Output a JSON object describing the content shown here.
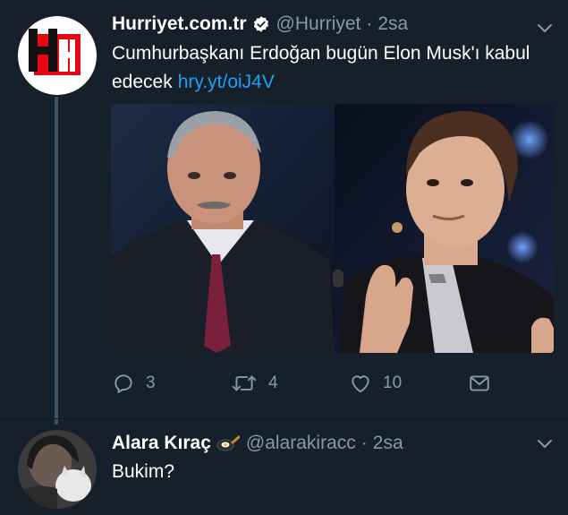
{
  "tweet": {
    "author_name": "Hurriyet.com.tr",
    "author_handle": "@Hurriyet",
    "separator": "·",
    "time": "2sa",
    "text": "Cumhurbaşkanı Erdoğan bugün Elon Musk'ı kabul edecek",
    "link": "hry.yt/oiJ4V",
    "actions": {
      "reply_count": "3",
      "retweet_count": "4",
      "like_count": "10"
    }
  },
  "reply": {
    "author_name": "Alara Kıraç",
    "author_handle": "@alarakiracc",
    "separator": "·",
    "time": "2sa",
    "text": "Bukim?"
  },
  "colors": {
    "background": "#15202b",
    "secondary_text": "#8899a6",
    "link": "#1da1f2",
    "logo_red": "#e30613"
  },
  "icons": [
    "hurriyet-logo",
    "verified-badge-icon",
    "chevron-down-icon",
    "reply-icon",
    "retweet-icon",
    "like-icon",
    "dm-icon",
    "frying-pan-emoji"
  ]
}
